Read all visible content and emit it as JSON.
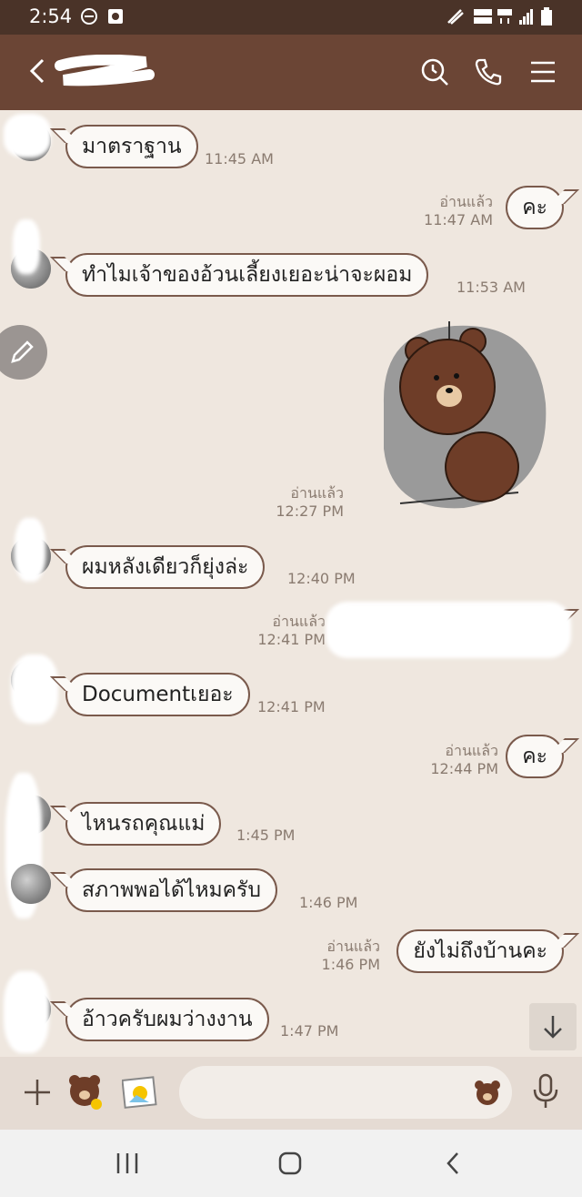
{
  "status_bar": {
    "time": "2:54"
  },
  "header": {
    "contact_name": ""
  },
  "messages": [
    {
      "dir": "in",
      "text": "มาตราฐาน",
      "time": "11:45 AM"
    },
    {
      "dir": "out",
      "text": "คะ",
      "read": "อ่านแล้ว",
      "time": "11:47 AM"
    },
    {
      "dir": "in",
      "text": "ทำไมเจ้าของอ้วนเลี้ยงเยอะน่าจะผอม",
      "time": "11:53 AM"
    },
    {
      "dir": "out",
      "type": "sticker",
      "sticker_name": "brown-bear-sad-sticker",
      "read": "อ่านแล้ว",
      "time": "12:27 PM"
    },
    {
      "dir": "in",
      "text": "ผมหลังเดียวก็ยุ่งล่ะ",
      "time": "12:40 PM"
    },
    {
      "dir": "out",
      "text": "",
      "read": "อ่านแล้ว",
      "time": "12:41 PM",
      "redacted": true
    },
    {
      "dir": "in",
      "text": "Documentเยอะ",
      "time": "12:41 PM"
    },
    {
      "dir": "out",
      "text": "คะ",
      "read": "อ่านแล้ว",
      "time": "12:44 PM"
    },
    {
      "dir": "in",
      "text": "ไหนรถคุณแม่",
      "time": "1:45 PM"
    },
    {
      "dir": "in",
      "text": "สภาพพอได้ไหมครับ",
      "time": "1:46 PM"
    },
    {
      "dir": "out",
      "text": "ยังไม่ถึงบ้านคะ",
      "read": "อ่านแล้ว",
      "time": "1:46 PM"
    },
    {
      "dir": "in",
      "text": "อ้าวครับผมว่างงาน",
      "time": "1:47 PM"
    }
  ],
  "input": {
    "placeholder": ""
  },
  "icons": {
    "back": "chevron-left-icon",
    "search": "search-history-icon",
    "call": "phone-icon",
    "menu": "hamburger-menu-icon",
    "add": "plus-icon",
    "sticker": "brown-bear-sticker-icon",
    "image": "image-icon",
    "emoji": "bear-emoji-icon",
    "mic": "microphone-icon",
    "scroll": "arrow-down-icon",
    "edit": "pencil-icon"
  },
  "colors": {
    "header": "#6b4535",
    "status_bar": "#4a3328",
    "chat_bg": "#efe7df",
    "bubble_border": "#7a5a4c"
  }
}
